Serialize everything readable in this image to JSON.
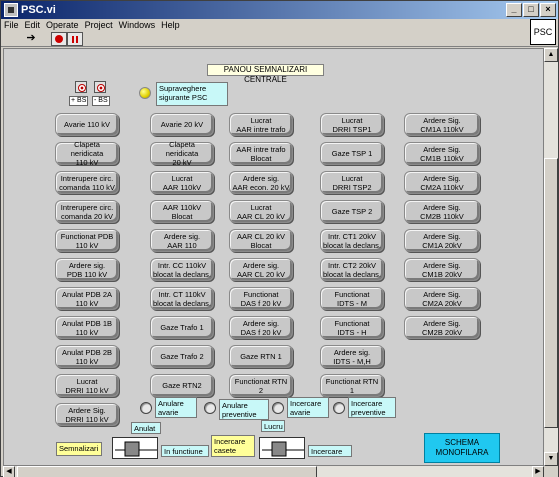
{
  "window": {
    "title": "PSC.vi",
    "vi_icon_text": "PSC"
  },
  "menu": [
    "File",
    "Edit",
    "Operate",
    "Project",
    "Windows",
    "Help"
  ],
  "panel": {
    "title": "PANOU SEMNALIZARI CENTRALE",
    "plus_bs": "+ BS",
    "minus_bs": "- BS",
    "supraveghere": "Supraveghere\nsigurante PSC",
    "led_color": "#f0e000"
  },
  "buttons": {
    "col1": [
      "Avarie 110 kV",
      "Clapeta neridicata\n110 kV",
      "Intrerupere circ.\ncomanda 110 kV",
      "Intrerupere circ.\ncomanda 20 kV",
      "Functionat PDB\n110 kV",
      "Ardere sig.\nPDB  110 kV",
      "Anulat PDB 2A\n110 kV",
      "Anulat PDB 1B\n110 kV",
      "Anulat PDB 2B\n110 kV",
      "Lucrat\nDRRI  110 kV",
      "Ardere Sig.\nDRRI  110 kV"
    ],
    "col2": [
      "Avarie 20 kV",
      "Clapeta neridicata\n20 kV",
      "Lucrat\nAAR 110kV",
      "AAR 110kV\nBlocat",
      "Ardere sig.\nAAR 110",
      "Intr. CC 110kV\nblocat la declans.",
      "Intr. CT 110kV\nblocat la declans.",
      "Gaze Trafo 1",
      "Gaze Trafo 2",
      "Gaze RTN2"
    ],
    "col3": [
      "Lucrat\nAAR intre trafo",
      "AAR intre trafo\nBlocat",
      "Ardere sig.\nAAR econ. 20 kV",
      "Lucrat\nAAR  CL  20 kV",
      "AAR  CL  20 kV\nBlocat",
      "Ardere sig.\nAAR  CL  20 kV",
      "Functionat\nDAS  f  20 kV",
      "Ardere sig.\nDAS  f  20 kV",
      "Gaze RTN 1",
      "Functionat  RTN 2"
    ],
    "col4": [
      "Lucrat\nDRRI  TSP1",
      "Gaze TSP 1",
      "Lucrat\nDRRI  TSP2",
      "Gaze TSP 2",
      "Intr. CT1 20kV\nblocat la declans.",
      "Intr. CT2 20kV\nblocat la declans.",
      "Functionat\nIDTS - M",
      "Functionat\nIDTS - H",
      "Ardere sig.\nIDTS - M,H",
      "Functionat  RTN 1"
    ],
    "col5": [
      "Ardere Sig.\nCM1A 110kV",
      "Ardere Sig.\nCM1B 110kV",
      "Ardere Sig.\nCM2A 110kV",
      "Ardere Sig.\nCM2B 110kV",
      "Ardere Sig.\nCM1A 20kV",
      "Ardere Sig.\nCM1B 20kV",
      "Ardere Sig.\nCM2A 20kV",
      "Ardere Sig.\nCM2B 20kV"
    ]
  },
  "radios": {
    "anulare_avarie": "Anulare\navarie",
    "anulare_preventive": "Anulare\npreventive",
    "incercare_avarie": "Incercare\navarie",
    "incercare_preventive": "Incercare\npreventive"
  },
  "bottom": {
    "anulat": "Anulat",
    "lucru": "Lucru",
    "semnalizari": "Semnalizari",
    "in_functiune": "In functiune",
    "incercare_casete": "Incercare\ncasete",
    "incercare": "Incercare",
    "schema": "SCHEMA\nMONOFILARA"
  }
}
